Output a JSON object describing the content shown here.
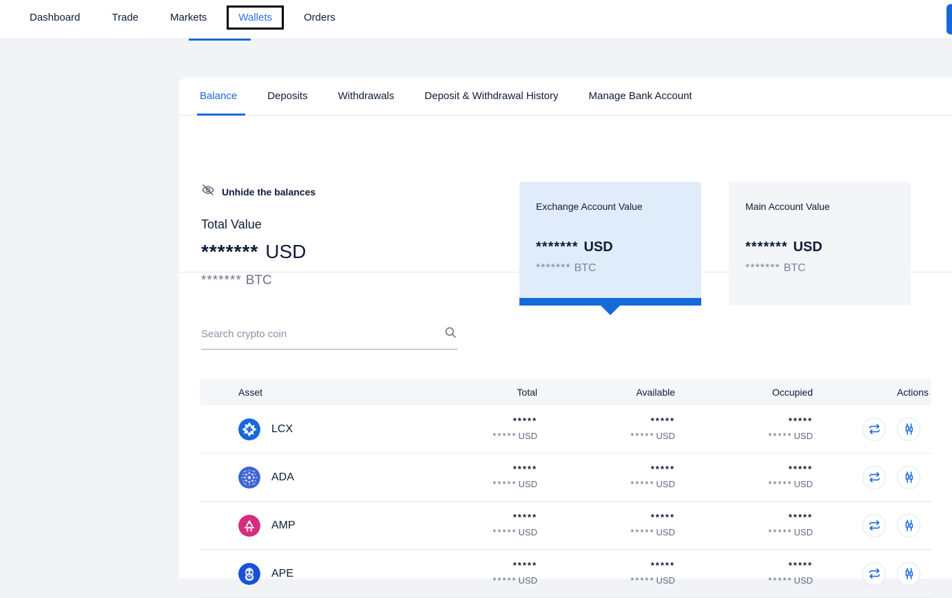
{
  "topnav": {
    "items": [
      {
        "label": "Dashboard",
        "focused": false
      },
      {
        "label": "Trade",
        "focused": false
      },
      {
        "label": "Markets",
        "focused": false
      },
      {
        "label": "Wallets",
        "focused": true
      },
      {
        "label": "Orders",
        "focused": false
      }
    ],
    "action_button_color": "#1669d8"
  },
  "tabs": [
    {
      "label": "Balance",
      "active": true
    },
    {
      "label": "Deposits",
      "active": false
    },
    {
      "label": "Withdrawals",
      "active": false
    },
    {
      "label": "Deposit & Withdrawal History",
      "active": false
    },
    {
      "label": "Manage Bank Account",
      "active": false
    }
  ],
  "balances": {
    "unhide_label": "Unhide the balances",
    "unhide_icon": "eye-off-icon",
    "total_label": "Total Value",
    "total_usd_value": "*******",
    "total_usd_unit": "USD",
    "total_btc_value": "*******",
    "total_btc_unit": "BTC",
    "cards": [
      {
        "title": "Exchange Account Value",
        "usd_value": "*******",
        "usd_unit": "USD",
        "btc_value": "*******",
        "btc_unit": "BTC",
        "selected": true
      },
      {
        "title": "Main Account Value",
        "usd_value": "*******",
        "usd_unit": "USD",
        "btc_value": "*******",
        "btc_unit": "BTC",
        "selected": false
      }
    ]
  },
  "search": {
    "placeholder": "Search crypto coin",
    "value": "",
    "icon": "search-icon"
  },
  "table": {
    "headers": [
      "Asset",
      "Total",
      "Available",
      "Occupied",
      "Actions"
    ],
    "rows": [
      {
        "symbol": "LCX",
        "icon": "lcx-coin-icon",
        "icon_color": "#1669d8",
        "total": "*****",
        "total_usd": "*****",
        "total_unit": "USD",
        "available": "*****",
        "available_usd": "*****",
        "available_unit": "USD",
        "occupied": "*****",
        "occupied_usd": "*****",
        "occupied_unit": "USD",
        "actions": [
          "transfer-icon",
          "candlestick-icon"
        ]
      },
      {
        "symbol": "ADA",
        "icon": "ada-coin-icon",
        "icon_color": "#3d63d4",
        "total": "*****",
        "total_usd": "*****",
        "total_unit": "USD",
        "available": "*****",
        "available_usd": "*****",
        "available_unit": "USD",
        "occupied": "*****",
        "occupied_usd": "*****",
        "occupied_unit": "USD",
        "actions": [
          "transfer-icon",
          "candlestick-icon"
        ]
      },
      {
        "symbol": "AMP",
        "icon": "amp-coin-icon",
        "icon_color": "#d62d7e",
        "total": "*****",
        "total_usd": "*****",
        "total_unit": "USD",
        "available": "*****",
        "available_usd": "*****",
        "available_unit": "USD",
        "occupied": "*****",
        "occupied_usd": "*****",
        "occupied_unit": "USD",
        "actions": [
          "transfer-icon",
          "candlestick-icon"
        ]
      },
      {
        "symbol": "APE",
        "icon": "ape-coin-icon",
        "icon_color": "#1b4fd8",
        "total": "*****",
        "total_usd": "*****",
        "total_unit": "USD",
        "available": "*****",
        "available_usd": "*****",
        "available_unit": "USD",
        "occupied": "*****",
        "occupied_usd": "*****",
        "occupied_unit": "USD",
        "actions": [
          "transfer-icon",
          "candlestick-icon"
        ]
      }
    ]
  }
}
